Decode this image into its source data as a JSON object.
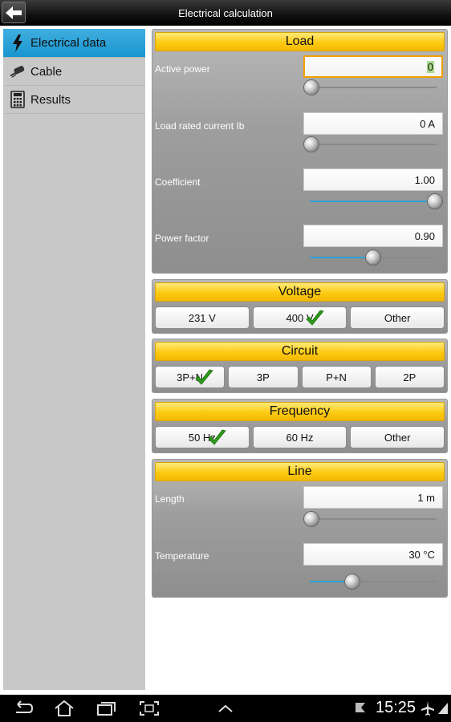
{
  "titlebar": {
    "title": "Electrical calculation"
  },
  "sidebar": {
    "items": [
      {
        "label": "Electrical data",
        "icon": "lightning-icon",
        "active": true
      },
      {
        "label": "Cable",
        "icon": "cable-icon",
        "active": false
      },
      {
        "label": "Results",
        "icon": "calculator-icon",
        "active": false
      }
    ]
  },
  "load": {
    "title": "Load",
    "active_power": {
      "label": "Active power",
      "value": "0"
    },
    "load_current": {
      "label": "Load rated current Ib",
      "value": "0 A"
    },
    "coefficient": {
      "label": "Coefficient",
      "value": "1.00"
    },
    "power_factor": {
      "label": "Power factor",
      "value": "0.90"
    }
  },
  "voltage": {
    "title": "Voltage",
    "options": [
      "231 V",
      "400 V",
      "Other"
    ],
    "selected": "400 V"
  },
  "circuit": {
    "title": "Circuit",
    "options": [
      "3P+N",
      "3P",
      "P+N",
      "2P"
    ],
    "selected": "3P+N"
  },
  "frequency": {
    "title": "Frequency",
    "options": [
      "50 Hz",
      "60 Hz",
      "Other"
    ],
    "selected": "50 Hz"
  },
  "line": {
    "title": "Line",
    "length": {
      "label": "Length",
      "value": "1 m"
    },
    "temperature": {
      "label": "Temperature",
      "value": "30 °C"
    }
  },
  "sliders": {
    "active_power": 0.0,
    "load_current": 0.0,
    "coefficient": 1.0,
    "power_factor": 0.5,
    "length": 0.0,
    "temperature": 0.33
  },
  "statusbar": {
    "time": "15:25"
  },
  "colors": {
    "accent": "#1996cf",
    "header_yellow": "#fccb13",
    "check_green": "#2e9a1c",
    "focus_orange": "#f0a000"
  }
}
